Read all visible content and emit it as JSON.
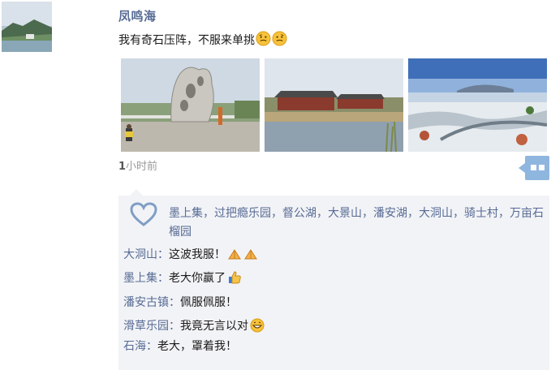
{
  "post": {
    "author": "凤鸣海",
    "text": "我有奇石压阵，不服来单挑",
    "emoji_after_text": [
      "thinking-face-icon",
      "thinking-face-icon"
    ],
    "photos": [
      {
        "alt": "奇石雕塑"
      },
      {
        "alt": "湖边木屋"
      },
      {
        "alt": "雪景湖面"
      }
    ],
    "time_number": "1",
    "time_suffix": "小时前"
  },
  "likes": {
    "names": "墨上集，过把瘾乐园，督公湖，大景山，潘安湖，大洞山，骑士村，万亩石榴园"
  },
  "comments": [
    {
      "author": "大洞山",
      "sep": "：",
      "text": "这波我服！",
      "emoji": [
        "fist-salute-icon",
        "fist-salute-icon"
      ]
    },
    {
      "author": "墨上集",
      "sep": "：",
      "text": "老大你赢了",
      "emoji": [
        "thumbs-up-icon"
      ]
    },
    {
      "author": "潘安古镇",
      "sep": "：",
      "text": "佩服佩服！",
      "emoji": []
    },
    {
      "author": "滑草乐园",
      "sep": "：",
      "text": "我竟无言以对",
      "emoji": [
        "grin-face-icon"
      ]
    },
    {
      "author": "石海",
      "sep": "：",
      "text": "老大，罩着我！",
      "emoji": []
    }
  ],
  "colors": {
    "name_blue": "#576b95",
    "comment_bg": "#f2f3f6",
    "more_button": "#8fb6df",
    "time_gray": "#9a9a9a"
  }
}
